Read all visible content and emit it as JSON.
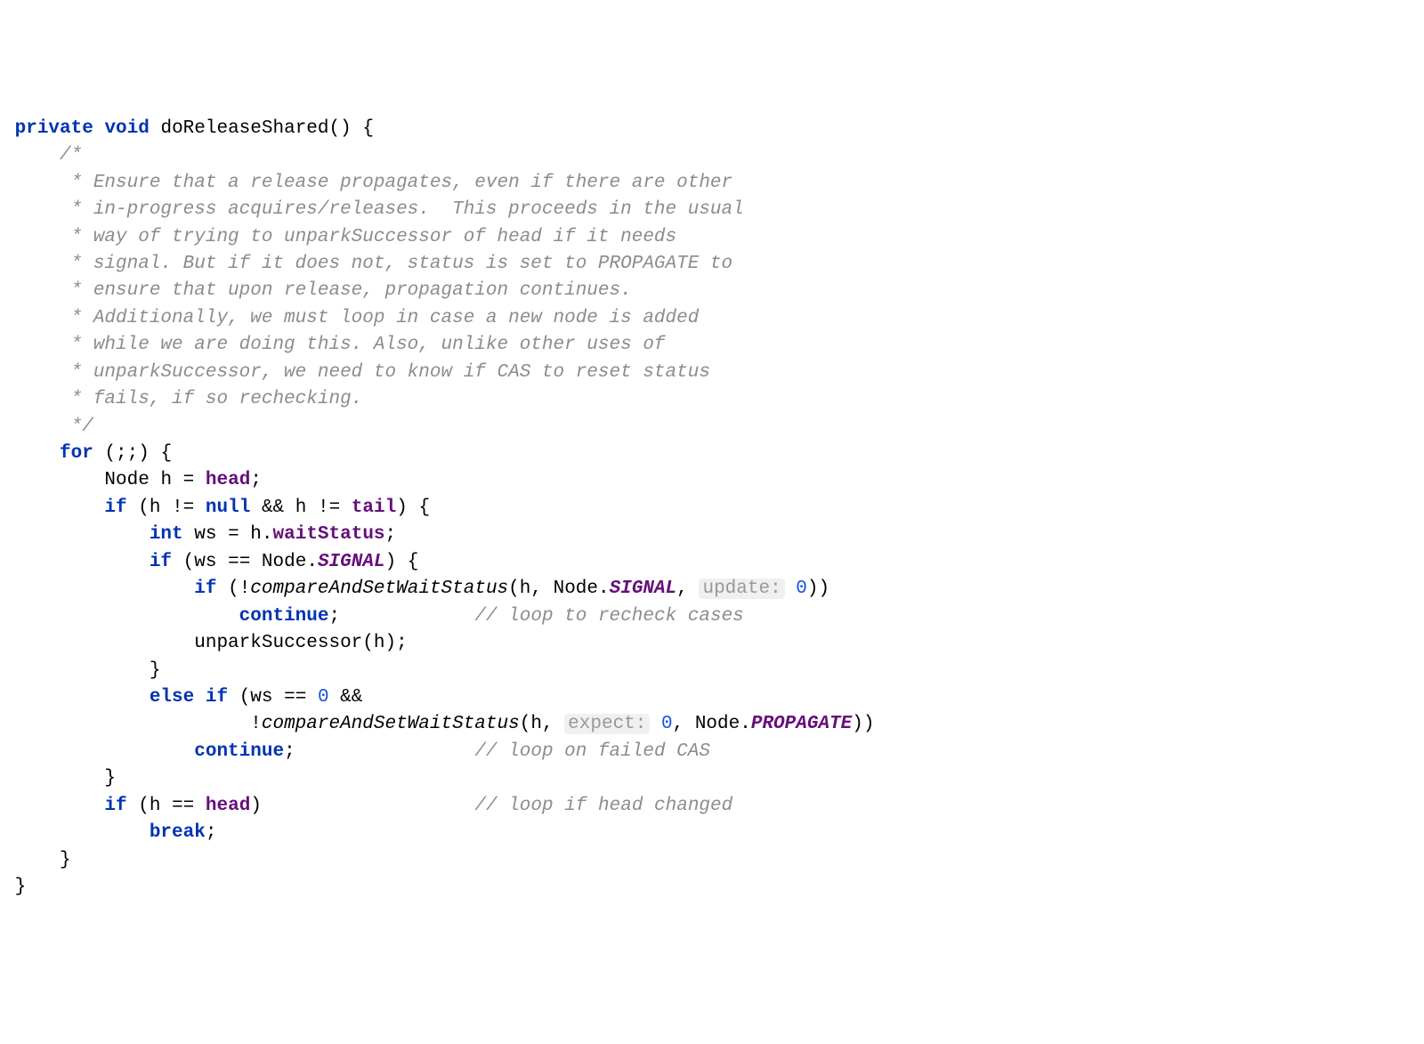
{
  "tokens": {
    "private": "private",
    "void": "void",
    "for": "for",
    "if": "if",
    "else": "else",
    "int": "int",
    "null": "null",
    "continue": "continue",
    "break": "break"
  },
  "identifiers": {
    "doReleaseShared": "doReleaseShared",
    "Node": "Node",
    "h": "h",
    "ws": "ws",
    "head": "head",
    "tail": "tail",
    "waitStatus": "waitStatus",
    "SIGNAL": "SIGNAL",
    "PROPAGATE": "PROPAGATE",
    "compareAndSetWaitStatus": "compareAndSetWaitStatus",
    "unparkSuccessor": "unparkSuccessor"
  },
  "comments": {
    "open": "/*",
    "l1": " * Ensure that a release propagates, even if there are other",
    "l2": " * in-progress acquires/releases.  This proceeds in the usual",
    "l3": " * way of trying to unparkSuccessor of head if it needs",
    "l4": " * signal. But if it does not, status is set to PROPAGATE to",
    "l5": " * ensure that upon release, propagation continues.",
    "l6": " * Additionally, we must loop in case a new node is added",
    "l7": " * while we are doing this. Also, unlike other uses of",
    "l8": " * unparkSuccessor, we need to know if CAS to reset status",
    "l9": " * fails, if so rechecking.",
    "close": " */",
    "c1": "// loop to recheck cases",
    "c2": "// loop on failed CAS",
    "c3": "// loop if head changed"
  },
  "hints": {
    "update": "update:",
    "expect": "expect:"
  },
  "nums": {
    "zero": "0"
  },
  "punct": {
    "lparen": "(",
    "rparen": ")",
    "lbrace": "{",
    "rbrace": "}",
    "semi": ";",
    "comma": ",",
    "dot": ".",
    "eq": "=",
    "bang": "!",
    "neq": "!=",
    "deq": "==",
    "andand": "&&",
    "dsemi": ";;"
  }
}
